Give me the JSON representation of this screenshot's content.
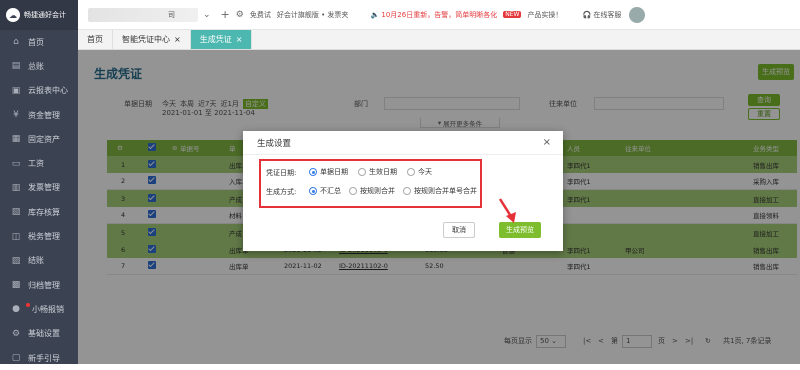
{
  "app": {
    "logo_text": "畅捷通好会计",
    "company_label": "司"
  },
  "topbar": {
    "trial_text": "免费试",
    "guide_text": "好会计旗舰版 • 发票夹",
    "notice_text": "10月26日重新，告警，简单明晰各化",
    "badge": "NEW",
    "product_text": "产品实操！",
    "service_text": "在线客服"
  },
  "sidebar": {
    "items": [
      {
        "label": "首页",
        "icon": "home-icon"
      },
      {
        "label": "总账",
        "icon": "ledger-icon"
      },
      {
        "label": "云报表中心",
        "icon": "report-icon"
      },
      {
        "label": "资金管理",
        "icon": "fund-icon"
      },
      {
        "label": "固定资产",
        "icon": "asset-icon"
      },
      {
        "label": "工资",
        "icon": "salary-icon"
      },
      {
        "label": "发票管理",
        "icon": "invoice-icon"
      },
      {
        "label": "库存核算",
        "icon": "inventory-icon"
      },
      {
        "label": "税务管理",
        "icon": "tax-icon"
      },
      {
        "label": "结账",
        "icon": "close-book-icon"
      },
      {
        "label": "归档管理",
        "icon": "archive-icon"
      },
      {
        "label": "小畅报销",
        "icon": "reimburse-icon"
      },
      {
        "label": "基础设置",
        "icon": "settings-icon"
      },
      {
        "label": "新手引导",
        "icon": "guide-icon"
      }
    ]
  },
  "tabs": [
    {
      "label": "首页",
      "closable": false
    },
    {
      "label": "智能凭证中心",
      "closable": true
    },
    {
      "label": "生成凭证",
      "closable": true,
      "active": true
    }
  ],
  "page": {
    "title": "生成凭证",
    "preview_button": "生成预览",
    "filters": {
      "date_label": "单据日期",
      "date_quick": [
        "今天",
        "本周",
        "近7天",
        "近1月",
        "自定义"
      ],
      "date_range": "2021-01-01 至 2021-11-04",
      "dept_label": "部门",
      "unit_label": "往来单位",
      "query_button": "查询",
      "reset_button": "重置",
      "expand_text": "展开更多条件"
    }
  },
  "table": {
    "headers": [
      "",
      "",
      "单据号",
      "单",
      "",
      "人员",
      "往来单位",
      "业务类型"
    ],
    "rows": [
      {
        "no": "1",
        "doc": "出库单",
        "date": "",
        "code": "",
        "amount": "",
        "person": "李四代1",
        "unit": "",
        "type": "销售出库",
        "green": true
      },
      {
        "no": "2",
        "doc": "入库单",
        "date": "",
        "code": "",
        "amount": "",
        "person": "李四代1",
        "unit": "",
        "type": "采购入库",
        "green": false
      },
      {
        "no": "3",
        "doc": "产成",
        "date": "",
        "code": "",
        "amount": "",
        "person": "李四代1",
        "unit": "",
        "type": "直接加工",
        "green": true
      },
      {
        "no": "4",
        "doc": "材料",
        "date": "",
        "code": "",
        "amount": "",
        "person": "",
        "unit": "",
        "type": "直接领料",
        "green": false
      },
      {
        "no": "5",
        "doc": "产成",
        "date": "",
        "code": "",
        "amount": "",
        "person": "",
        "unit": "",
        "type": "直接加工",
        "green": true
      },
      {
        "no": "6",
        "doc": "出库单",
        "date": "2021-11-02",
        "code": "ID-20211102-0",
        "amount": "133.81",
        "person": "李四代1",
        "unit": "甲公司",
        "type": "销售出库",
        "green": true,
        "person2": "普通"
      },
      {
        "no": "7",
        "doc": "出库单",
        "date": "2021-11-02",
        "code": "ID-20211102-0",
        "amount": "52.50",
        "person": "李四代1",
        "unit": "",
        "type": "销售出库",
        "green": false
      }
    ]
  },
  "pager": {
    "per_page_label": "每页显示",
    "per_page": "50",
    "page_prefix": "第",
    "page_value": "1",
    "page_suffix": "页",
    "summary": "共1页, 7条记录"
  },
  "modal": {
    "title": "生成设置",
    "voucher_date_label": "凭证日期:",
    "voucher_date_options": [
      "单据日期",
      "生效日期",
      "今天"
    ],
    "voucher_date_selected": 0,
    "mode_label": "生成方式:",
    "mode_options": [
      "不汇总",
      "按规则合并",
      "按规则合并单号合并"
    ],
    "mode_selected": 0,
    "cancel_button": "取消",
    "confirm_button": "生成预览"
  },
  "colors": {
    "accent_green": "#7ebd2d",
    "highlight_red": "#e53238",
    "sidebar_bg": "#3b4251",
    "active_tab": "#4db8b0"
  }
}
